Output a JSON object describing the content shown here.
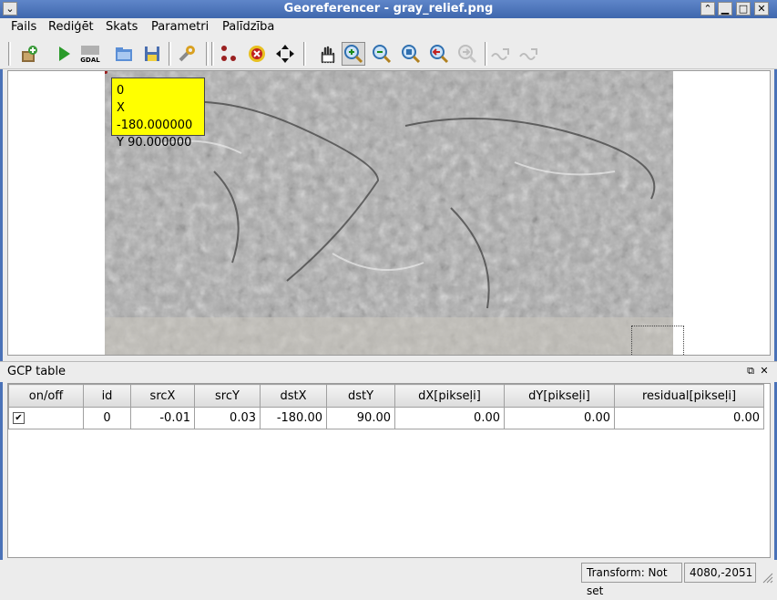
{
  "window": {
    "title": "Georeferencer - gray_relief.png"
  },
  "menu": [
    "Fails",
    "Rediģēt",
    "Skats",
    "Parametri",
    "Palīdzība"
  ],
  "toolbar": {
    "icons": [
      "open-raster-icon",
      "start-georeferencing-icon",
      "generate-gdal-script-icon",
      "load-gcp-icon",
      "save-gcp-icon",
      "transformation-settings-icon",
      "add-point-icon",
      "delete-point-icon",
      "move-gcp-icon",
      "pan-icon",
      "zoom-in-icon",
      "zoom-out-icon",
      "zoom-to-layer-icon",
      "zoom-last-icon",
      "zoom-next-icon",
      "link-georef-to-qgis-icon",
      "link-qgis-to-georef-icon"
    ],
    "gdal_label": "GDAL"
  },
  "map_tooltip": {
    "id": "0",
    "x": "X -180.000000",
    "y": "Y 90.000000"
  },
  "gcp_panel": {
    "title": "GCP table",
    "columns": [
      "on/off",
      "id",
      "srcX",
      "srcY",
      "dstX",
      "dstY",
      "dX[pikseļi]",
      "dY[pikseļi]",
      "residual[pikseļi]"
    ],
    "rows": [
      {
        "enabled": true,
        "id": "0",
        "srcX": "-0.01",
        "srcY": "0.03",
        "dstX": "-180.00",
        "dstY": "90.00",
        "dX": "0.00",
        "dY": "0.00",
        "residual": "0.00"
      }
    ]
  },
  "status": {
    "transform": "Transform: Not set",
    "coords": "4080,-2051"
  }
}
